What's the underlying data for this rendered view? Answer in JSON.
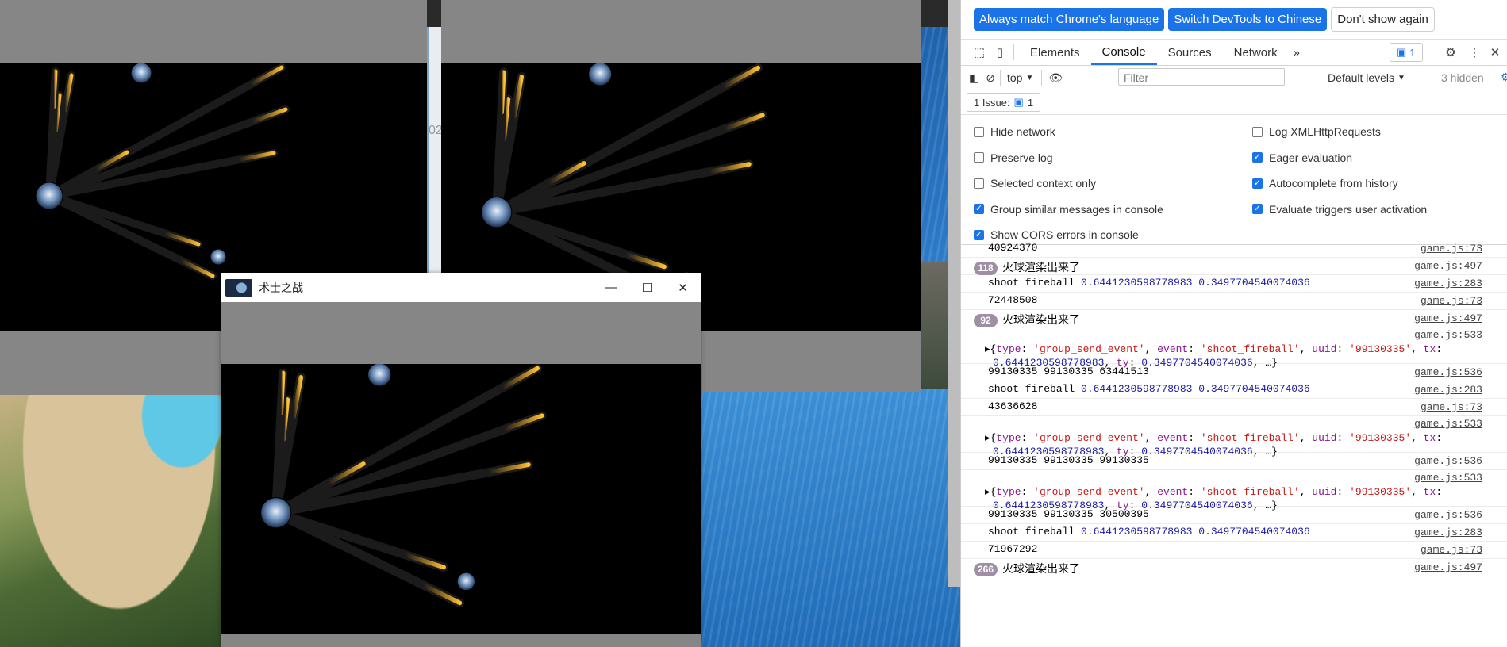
{
  "desktop": {},
  "front_window": {
    "title": "术士之战",
    "controls": {
      "minimize": "—",
      "maximize": "☐",
      "close": "✕"
    }
  },
  "background_text": "02",
  "devtools": {
    "banner": {
      "match_language": "Always match Chrome's language",
      "switch_chinese": "Switch DevTools to Chinese",
      "dont_show": "Don't show again"
    },
    "tabs": [
      "Elements",
      "Console",
      "Sources",
      "Network"
    ],
    "more_tabs": "»",
    "issue_count": "1",
    "console_toolbar": {
      "context": "top",
      "filter_placeholder": "Filter",
      "levels": "Default levels",
      "hidden": "3 hidden"
    },
    "issues_label": "1 Issue:",
    "issues_count": "1",
    "settings_left": [
      {
        "label": "Hide network",
        "checked": false
      },
      {
        "label": "Preserve log",
        "checked": false
      },
      {
        "label": "Selected context only",
        "checked": false
      },
      {
        "label": "Group similar messages in console",
        "checked": true
      },
      {
        "label": "Show CORS errors in console",
        "checked": true
      }
    ],
    "settings_right": [
      {
        "label": "Log XMLHttpRequests",
        "checked": false
      },
      {
        "label": "Eager evaluation",
        "checked": true
      },
      {
        "label": "Autocomplete from history",
        "checked": true
      },
      {
        "label": "Evaluate triggers user activation",
        "checked": true
      }
    ],
    "log": [
      {
        "kind": "plain",
        "text": "40924370",
        "src": "game.js:73"
      },
      {
        "kind": "count",
        "count": "118",
        "text": "火球渲染出来了",
        "src": "game.js:497"
      },
      {
        "kind": "fire",
        "text": "shoot fireball",
        "a": "0.6441230598778983",
        "b": "0.3497704540074036",
        "src": "game.js:283"
      },
      {
        "kind": "plain",
        "text": "72448508",
        "src": "game.js:73"
      },
      {
        "kind": "count",
        "count": "92",
        "text": "火球渲染出来了",
        "src": "game.js:497"
      },
      {
        "kind": "obj",
        "src": "game.js:533",
        "type": "'group_send_event'",
        "event": "'shoot_fireball'",
        "uuid": "'99130335'",
        "tx": "0.6441230598778983",
        "ty": "0.3497704540074036"
      },
      {
        "kind": "plain",
        "text": "99130335 99130335 63441513",
        "src": "game.js:536"
      },
      {
        "kind": "fire",
        "text": "shoot fireball",
        "a": "0.6441230598778983",
        "b": "0.3497704540074036",
        "src": "game.js:283"
      },
      {
        "kind": "plain",
        "text": "43636628",
        "src": "game.js:73"
      },
      {
        "kind": "obj",
        "src": "game.js:533",
        "type": "'group_send_event'",
        "event": "'shoot_fireball'",
        "uuid": "'99130335'",
        "tx": "0.6441230598778983",
        "ty": "0.3497704540074036"
      },
      {
        "kind": "plain",
        "text": "99130335 99130335 99130335",
        "src": "game.js:536"
      },
      {
        "kind": "obj",
        "src": "game.js:533",
        "type": "'group_send_event'",
        "event": "'shoot_fireball'",
        "uuid": "'99130335'",
        "tx": "0.6441230598778983",
        "ty": "0.3497704540074036"
      },
      {
        "kind": "plain",
        "text": "99130335 99130335 30500395",
        "src": "game.js:536"
      },
      {
        "kind": "fire",
        "text": "shoot fireball",
        "a": "0.6441230598778983",
        "b": "0.3497704540074036",
        "src": "game.js:283"
      },
      {
        "kind": "plain",
        "text": "71967292",
        "src": "game.js:73"
      },
      {
        "kind": "count",
        "count": "266",
        "text": "火球渲染出来了",
        "src": "game.js:497"
      }
    ]
  }
}
